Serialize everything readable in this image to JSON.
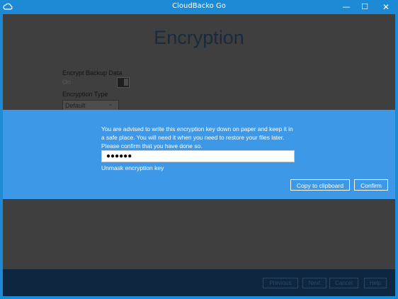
{
  "window": {
    "title": "CloudBacko Go",
    "min": "—",
    "max": "☐",
    "close": "✕"
  },
  "page": {
    "title": "Encryption"
  },
  "encrypt": {
    "label": "Encrypt Backup Data",
    "state": "On"
  },
  "type": {
    "label": "Encryption Type",
    "selected": "Default",
    "options": [
      "Default"
    ]
  },
  "modal": {
    "lines": [
      "You are advised to write this encryption key down on paper and keep it in",
      "a safe place. You will need it when you need to restore your files later.",
      "Please confirm that you have done so."
    ],
    "key_value": "●●●●●●",
    "unmask": "Unmask encryption key",
    "copy": "Copy to clipboard",
    "confirm": "Confirm"
  },
  "footer": {
    "previous": "Previous",
    "next": "Next",
    "cancel": "Cancel",
    "help": "Help"
  },
  "colors": {
    "titlebar": "#1d8ad6",
    "modal": "#3e98e8",
    "footer": "#0e2640",
    "overlay": "#3f3f3f"
  }
}
